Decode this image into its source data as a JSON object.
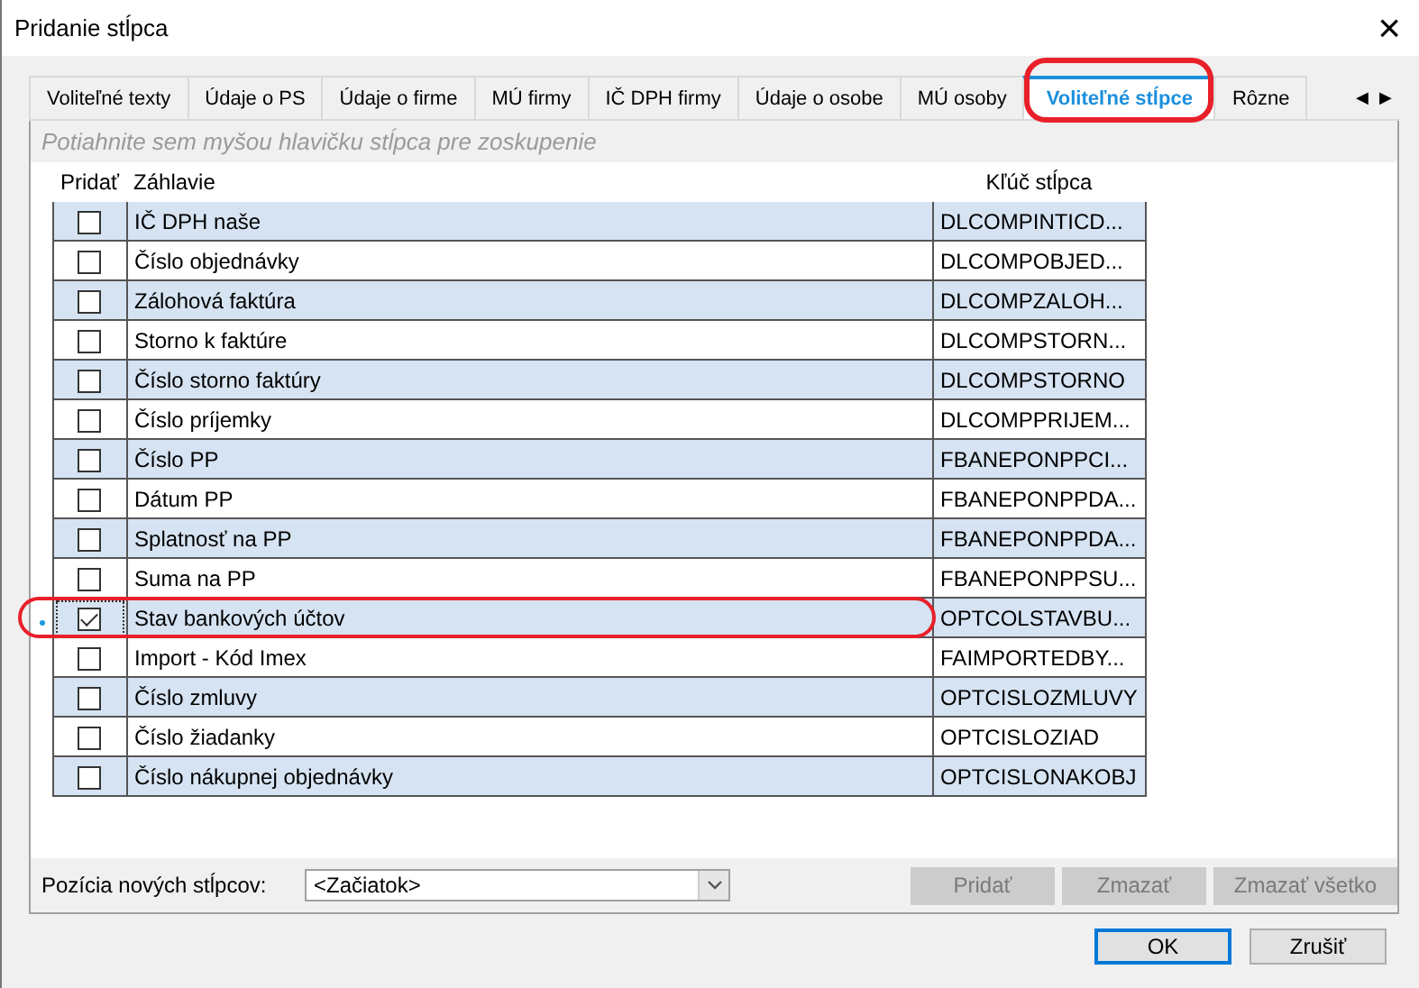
{
  "window": {
    "title": "Pridanie stĺpca",
    "close": "×"
  },
  "tabs": [
    {
      "label": "Voliteľné texty",
      "selected": false
    },
    {
      "label": "Údaje o PS",
      "selected": false
    },
    {
      "label": "Údaje o firme",
      "selected": false
    },
    {
      "label": "MÚ firmy",
      "selected": false
    },
    {
      "label": "IČ DPH firmy",
      "selected": false
    },
    {
      "label": "Údaje o osobe",
      "selected": false
    },
    {
      "label": "MÚ osoby",
      "selected": false
    },
    {
      "label": "Voliteľné stĺpce",
      "selected": true
    },
    {
      "label": "Rôzne",
      "selected": false
    }
  ],
  "tab_scroll": [
    "◀",
    "▶"
  ],
  "group_panel": {
    "placeholder": "Potiahnite sem myšou hlavičku stĺpca pre zoskupenie"
  },
  "table": {
    "columns": [
      "Pridať",
      "Záhlavie",
      "Kľúč stĺpca"
    ],
    "rows": [
      {
        "checked": false,
        "selected": false,
        "title": "IČ DPH naše",
        "key": "DLCOMPINTICD..."
      },
      {
        "checked": false,
        "selected": false,
        "title": "Číslo objednávky",
        "key": "DLCOMPOBJED..."
      },
      {
        "checked": false,
        "selected": false,
        "title": "Zálohová faktúra",
        "key": "DLCOMPZALOH..."
      },
      {
        "checked": false,
        "selected": false,
        "title": "Storno k faktúre",
        "key": "DLCOMPSTORN..."
      },
      {
        "checked": false,
        "selected": false,
        "title": "Číslo storno faktúry",
        "key": "DLCOMPSTORNO"
      },
      {
        "checked": false,
        "selected": false,
        "title": "Číslo príjemky",
        "key": "DLCOMPPRIJEM..."
      },
      {
        "checked": false,
        "selected": false,
        "title": "Číslo PP",
        "key": "FBANEPONPPCI..."
      },
      {
        "checked": false,
        "selected": false,
        "title": "Dátum PP",
        "key": "FBANEPONPPDA..."
      },
      {
        "checked": false,
        "selected": false,
        "title": "Splatnosť na PP",
        "key": "FBANEPONPPDA..."
      },
      {
        "checked": false,
        "selected": false,
        "title": "Suma na PP",
        "key": "FBANEPONPPSU..."
      },
      {
        "checked": true,
        "selected": true,
        "title": "Stav bankových účtov",
        "key": "OPTCOLSTAVBU..."
      },
      {
        "checked": false,
        "selected": false,
        "title": "Import - Kód Imex",
        "key": "FAIMPORTEDBY..."
      },
      {
        "checked": false,
        "selected": false,
        "title": "Číslo zmluvy",
        "key": "OPTCISLOZMLUVY"
      },
      {
        "checked": false,
        "selected": false,
        "title": "Číslo žiadanky",
        "key": "OPTCISLOZIAD"
      },
      {
        "checked": false,
        "selected": false,
        "title": "Číslo nákupnej objednávky",
        "key": "OPTCISLONAKOBJ"
      }
    ]
  },
  "position": {
    "label": "Pozícia nových stĺpcov:",
    "value": "<Začiatok>"
  },
  "grid_buttons": [
    {
      "label": "Pridať",
      "disabled": true
    },
    {
      "label": "Zmazať",
      "disabled": true
    },
    {
      "label": "Zmazať všetko",
      "disabled": true
    }
  ],
  "dialog_buttons": [
    {
      "label": "OK",
      "default": true
    },
    {
      "label": "Zrušiť",
      "default": false
    }
  ]
}
